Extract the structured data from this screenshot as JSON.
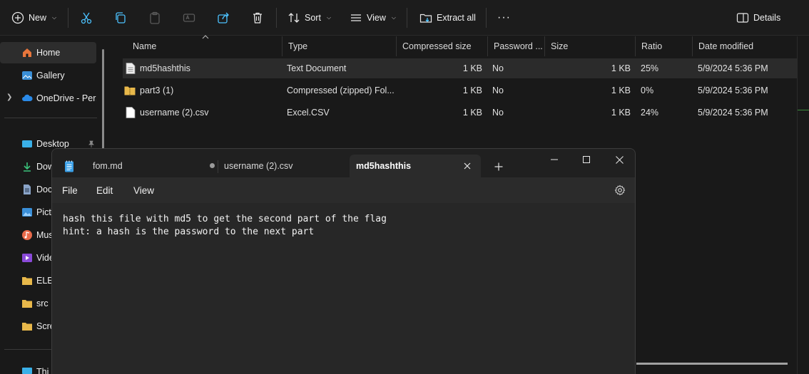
{
  "toolbar": {
    "new_label": "New",
    "sort_label": "Sort",
    "view_label": "View",
    "extract_label": "Extract all",
    "more_label": "···",
    "details_label": "Details"
  },
  "sidebar": {
    "items": [
      {
        "label": "Home"
      },
      {
        "label": "Gallery"
      },
      {
        "label": "OneDrive - Perso"
      },
      {
        "label": "Desktop"
      },
      {
        "label": "Dow"
      },
      {
        "label": "Doc"
      },
      {
        "label": "Pict"
      },
      {
        "label": "Mus"
      },
      {
        "label": "Vide"
      },
      {
        "label": "ELEC"
      },
      {
        "label": "src"
      },
      {
        "label": "Scre"
      },
      {
        "label": "Thi"
      }
    ]
  },
  "filelist": {
    "columns": [
      "Name",
      "Type",
      "Compressed size",
      "Password ...",
      "Size",
      "Ratio",
      "Date modified"
    ],
    "rows": [
      {
        "name": "md5hashthis",
        "type": "Text Document",
        "compressed": "1 KB",
        "password": "No",
        "size": "1 KB",
        "ratio": "25%",
        "date": "5/9/2024 5:36 PM"
      },
      {
        "name": "part3 (1)",
        "type": "Compressed (zipped) Fol...",
        "compressed": "1 KB",
        "password": "No",
        "size": "1 KB",
        "ratio": "0%",
        "date": "5/9/2024 5:36 PM"
      },
      {
        "name": "username (2).csv",
        "type": "Excel.CSV",
        "compressed": "1 KB",
        "password": "No",
        "size": "1 KB",
        "ratio": "24%",
        "date": "5/9/2024 5:36 PM"
      }
    ]
  },
  "notepad": {
    "tabs": [
      {
        "label": "fom.md"
      },
      {
        "label": "username (2).csv"
      },
      {
        "label": "md5hashthis"
      }
    ],
    "menu": {
      "file": "File",
      "edit": "Edit",
      "view": "View"
    },
    "lines": [
      "hash this file with md5 to get the second part of the flag",
      "hint: a hash is the password to the next part"
    ]
  },
  "colors": {
    "accent": "#4cc2ff",
    "folder": "#e8b84a",
    "background": "#191919"
  }
}
